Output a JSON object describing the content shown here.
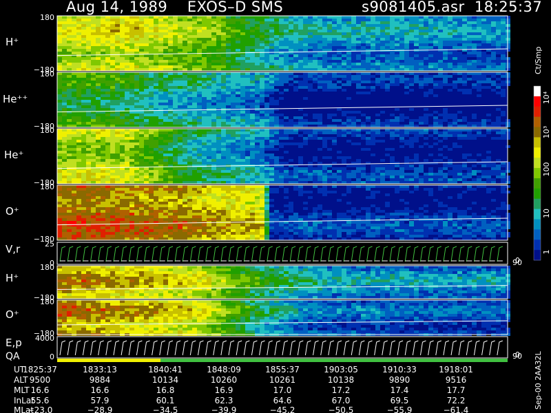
{
  "header": {
    "title": "Aug 14, 1989    EXOS–D SMS",
    "file": "s9081405.asr  18:25:37"
  },
  "colorbar": {
    "unit": "Ct/Smp",
    "ticks": [
      "10⁴",
      "10³",
      "100",
      "10",
      "1"
    ],
    "colors": [
      "#ffffff",
      "#ff0000",
      "#e02000",
      "#b06000",
      "#8a6a00",
      "#c8c000",
      "#f0f000",
      "#c0e020",
      "#80c800",
      "#40a000",
      "#20a000",
      "#20a060",
      "#20c0c0",
      "#0090c0",
      "#0060c0",
      "#0030b0",
      "#00108a"
    ]
  },
  "chart_data": [
    {
      "type": "heatmap",
      "name": "H+",
      "ylabel": "H⁺",
      "yticks": [
        "180",
        "−180"
      ],
      "intensity": [
        [
          0,
          0.55
        ],
        [
          0.15,
          0.6
        ],
        [
          0.35,
          0.45
        ],
        [
          0.5,
          0.25
        ],
        [
          0.6,
          0.2
        ],
        [
          0.75,
          0.2
        ],
        [
          1,
          0.15
        ]
      ]
    },
    {
      "type": "heatmap",
      "name": "He++",
      "ylabel": "He⁺⁺",
      "yticks": [
        "180",
        "−180"
      ],
      "intensity": [
        [
          0,
          0.4
        ],
        [
          0.12,
          0.38
        ],
        [
          0.2,
          0.3
        ],
        [
          0.45,
          0.18
        ],
        [
          0.5,
          0.05
        ],
        [
          1,
          0.04
        ]
      ]
    },
    {
      "type": "heatmap",
      "name": "He+",
      "ylabel": "He⁺",
      "yticks": [
        "180",
        "−180"
      ],
      "intensity": [
        [
          0,
          0.55
        ],
        [
          0.15,
          0.55
        ],
        [
          0.3,
          0.3
        ],
        [
          0.45,
          0.2
        ],
        [
          0.5,
          0.07
        ],
        [
          1,
          0.06
        ]
      ]
    },
    {
      "type": "heatmap",
      "name": "O+",
      "ylabel": "O⁺",
      "yticks": [
        "180",
        "−180"
      ],
      "intensity": [
        [
          0,
          0.78
        ],
        [
          0.2,
          0.75
        ],
        [
          0.45,
          0.62
        ],
        [
          0.47,
          0.08
        ],
        [
          1,
          0.06
        ]
      ]
    },
    {
      "type": "line",
      "name": "V,r",
      "ylabel": "V,r",
      "yticks": [
        "25",
        "0"
      ],
      "rticks": [
        "90",
        "0"
      ]
    },
    {
      "type": "heatmap",
      "name": "H+ (E)",
      "ylabel": "H⁺",
      "yticks": [
        "180",
        "−180"
      ],
      "intensity": [
        [
          0,
          0.72
        ],
        [
          0.3,
          0.6
        ],
        [
          0.45,
          0.35
        ],
        [
          0.6,
          0.22
        ],
        [
          1,
          0.18
        ]
      ]
    },
    {
      "type": "heatmap",
      "name": "O+ (E)",
      "ylabel": "O⁺",
      "yticks": [
        "180",
        "−180"
      ],
      "intensity": [
        [
          0,
          0.75
        ],
        [
          0.3,
          0.6
        ],
        [
          0.45,
          0.3
        ],
        [
          0.55,
          0.15
        ],
        [
          1,
          0.1
        ]
      ]
    },
    {
      "type": "line",
      "name": "E,p",
      "ylabel": "E,p",
      "yticks": [
        "4000",
        "0"
      ],
      "rticks": [
        "90",
        "0"
      ]
    }
  ],
  "qa_label": "QA",
  "ephemeris": {
    "rows": [
      {
        "label": "UT",
        "values": [
          "1825:37",
          "1833:13",
          "1840:41",
          "1848:09",
          "1855:37",
          "1903:05",
          "1910:33",
          "1918:01"
        ]
      },
      {
        "label": "ALT",
        "values": [
          "9500",
          "9884",
          "10134",
          "10260",
          "10261",
          "10138",
          "9890",
          "9516"
        ]
      },
      {
        "label": "MLT",
        "values": [
          "16.6",
          "16.6",
          "16.8",
          "16.9",
          "17.0",
          "17.2",
          "17.4",
          "17.7"
        ]
      },
      {
        "label": "InLat",
        "values": [
          "55.6",
          "57.9",
          "60.1",
          "62.3",
          "64.6",
          "67.0",
          "69.5",
          "72.2"
        ]
      },
      {
        "label": "MLat",
        "values": [
          "−23.0",
          "−28.9",
          "−34.5",
          "−39.9",
          "−45.2",
          "−50.5",
          "−55.9",
          "−61.4"
        ]
      }
    ]
  },
  "side_label": "Sep-00  2AA32L"
}
